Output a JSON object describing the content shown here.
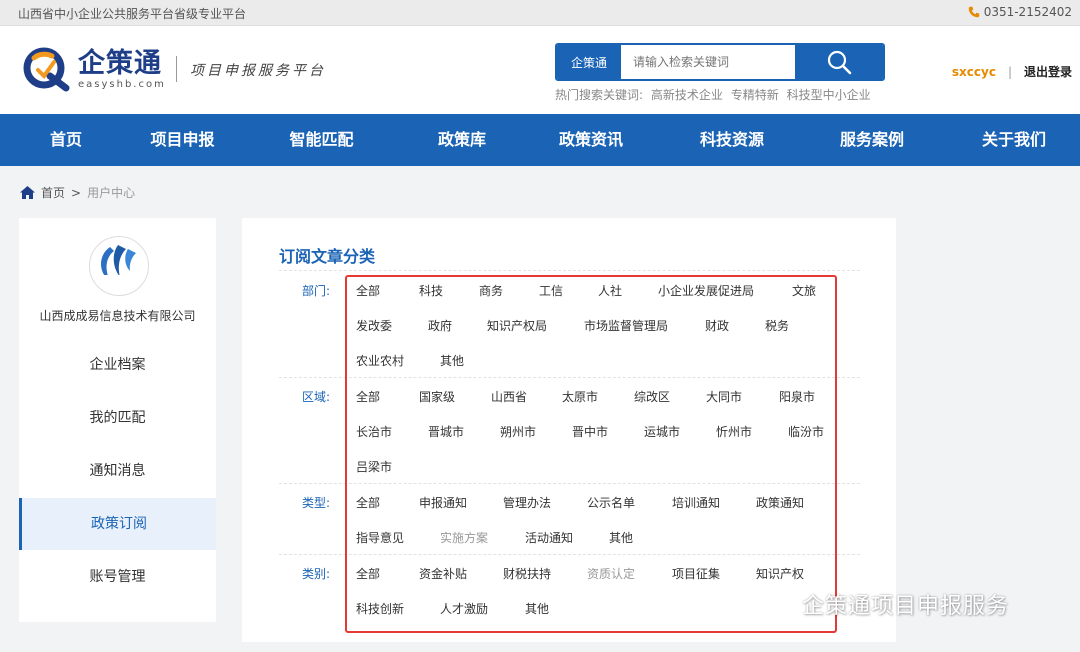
{
  "topbar": {
    "left_text": "山西省中小企业公共服务平台省级专业平台",
    "phone": "0351-2152402"
  },
  "header": {
    "logo_cn": "企策通",
    "logo_en": "easyshb.com",
    "slogan": "项目申报服务平台",
    "search_category": "企策通",
    "search_placeholder": "请输入检索关键词",
    "hot_label": "热门搜索关键词:",
    "hot_keywords": [
      "高新技术企业",
      "专精特新",
      "科技型中小企业"
    ],
    "username": "sxccyc",
    "separator": "|",
    "logout": "退出登录"
  },
  "nav": {
    "items": [
      "首页",
      "项目申报",
      "智能匹配",
      "政策库",
      "政策资讯",
      "科技资源",
      "服务案例",
      "关于我们"
    ]
  },
  "breadcrumb": {
    "home": "首页",
    "current": "用户中心"
  },
  "sidebar": {
    "company": "山西成成易信息技术有限公司",
    "items": [
      "企业档案",
      "我的匹配",
      "通知消息",
      "政策订阅",
      "账号管理"
    ],
    "active_index": 3
  },
  "main": {
    "title": "订阅文章分类",
    "groups": [
      {
        "label": "部门:",
        "rows": [
          [
            "全部",
            "科技",
            "商务",
            "工信",
            "人社",
            "小企业发展促进局",
            "文旅"
          ],
          [
            "发改委",
            "政府",
            "知识产权局",
            "市场监督管理局",
            "财政",
            "税务"
          ],
          [
            "农业农村",
            "其他"
          ]
        ]
      },
      {
        "label": "区域:",
        "rows": [
          [
            "全部",
            "国家级",
            "山西省",
            "太原市",
            "综改区",
            "大同市",
            "阳泉市"
          ],
          [
            "长治市",
            "晋城市",
            "朔州市",
            "晋中市",
            "运城市",
            "忻州市",
            "临汾市"
          ],
          [
            "吕梁市"
          ]
        ]
      },
      {
        "label": "类型:",
        "rows": [
          [
            "全部",
            "申报通知",
            "管理办法",
            "公示名单",
            "培训通知",
            "政策通知"
          ],
          [
            "指导意见",
            "实施方案",
            "活动通知",
            "其他"
          ]
        ]
      },
      {
        "label": "类别:",
        "rows": [
          [
            "全部",
            "资金补贴",
            "财税扶持",
            "资质认定",
            "项目征集",
            "知识产权"
          ],
          [
            "科技创新",
            "人才激励",
            "其他"
          ]
        ]
      }
    ]
  },
  "watermark": "企策通项目申报服务",
  "colors": {
    "primary": "#1a63b5",
    "accent": "#e68a00",
    "highlight_box": "#e53935"
  }
}
